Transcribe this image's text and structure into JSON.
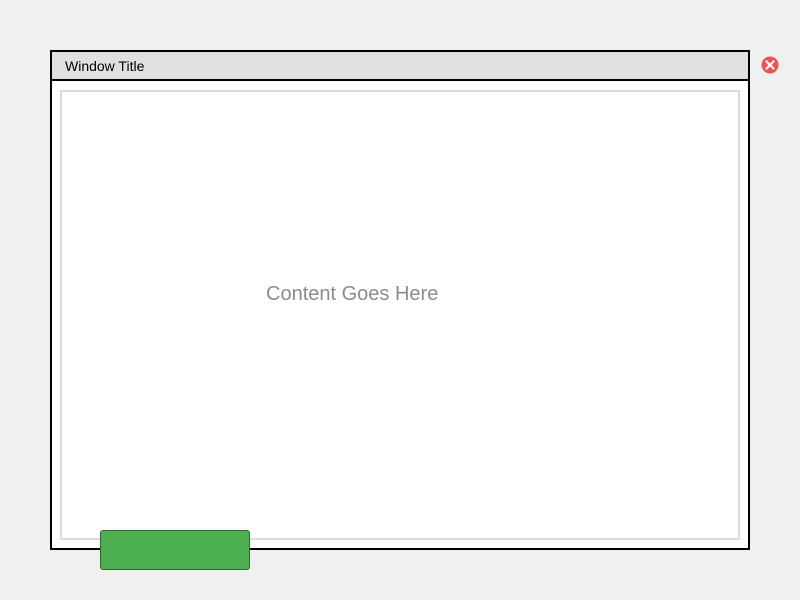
{
  "window": {
    "title": "Window Title"
  },
  "content": {
    "placeholder": "Content Goes Here"
  },
  "icons": {
    "close": "close-icon"
  },
  "colors": {
    "page_background": "#f0f0f0",
    "titlebar_background": "#e0e0e0",
    "close_icon": "#ef5350",
    "action_button": "#4caf50"
  }
}
